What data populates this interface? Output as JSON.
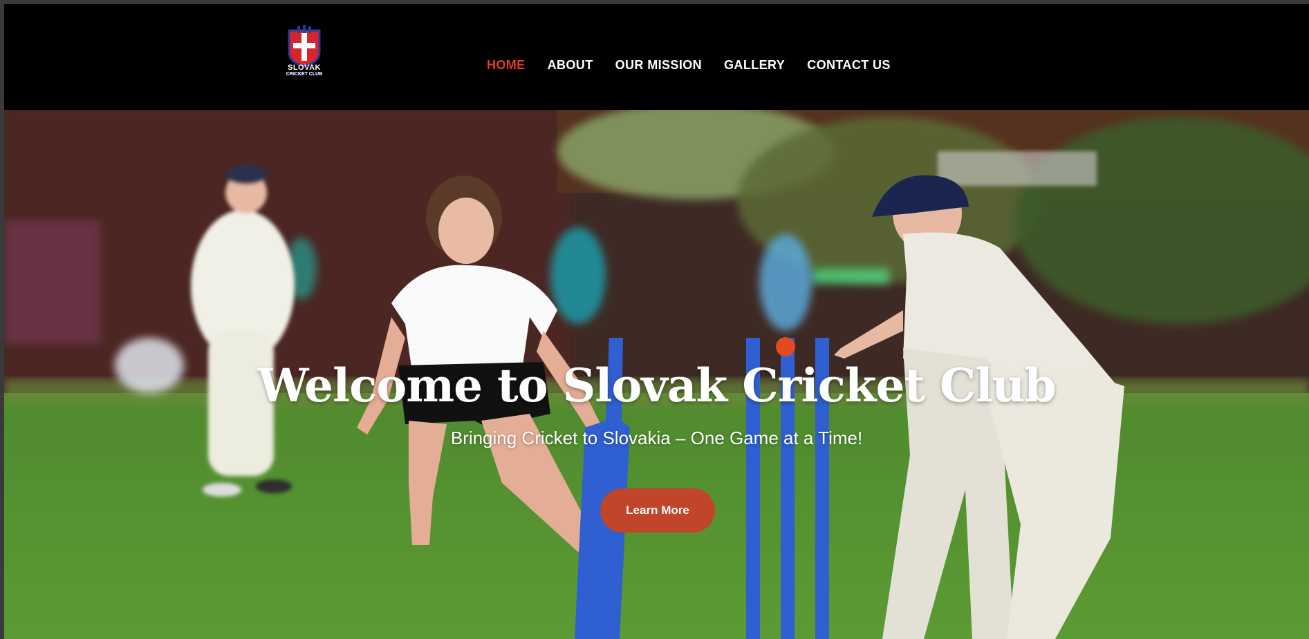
{
  "logo": {
    "line1": "SLOVAK",
    "line2": "CRICKET CLUB",
    "brand_red": "#d6262c",
    "brand_blue": "#2b3a9e"
  },
  "nav": {
    "items": [
      {
        "label": "HOME",
        "active": true
      },
      {
        "label": "ABOUT",
        "active": false
      },
      {
        "label": "OUR MISSION",
        "active": false
      },
      {
        "label": "GALLERY",
        "active": false
      },
      {
        "label": "CONTACT US",
        "active": false
      }
    ],
    "active_color": "#e03b2a"
  },
  "hero": {
    "title": "Welcome to Slovak Cricket Club",
    "subtitle": "Bringing Cricket to Slovakia – One Game at a Time!",
    "cta_label": "Learn More",
    "cta_color": "#c0452a"
  }
}
